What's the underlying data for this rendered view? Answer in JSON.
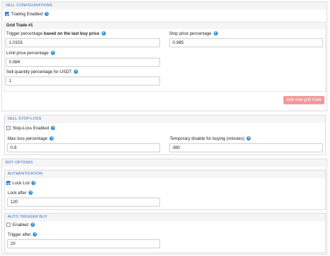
{
  "sell_configurations": {
    "header": "SELL CONFIGURATIONS",
    "trading_enabled_label": "Trading Enabled",
    "trading_enabled_checked": true,
    "grid_title": "Grid Trade #1",
    "trigger_label_pre": "Trigger percentage",
    "trigger_label_bold": "based on the last buy price",
    "trigger_value": "1.0153",
    "stop_price_label": "Stop price percentage",
    "stop_price_value": "0.985",
    "limit_price_label": "Limit price percentage",
    "limit_price_value": "0.984",
    "sell_qty_label": "Sell quantity percentage for USDT",
    "sell_qty_value": "1",
    "add_button": "Add new grid trade"
  },
  "sell_stop_loss": {
    "header": "SELL STOP-LOSS",
    "enabled_label": "Stop-Loss Enabled",
    "enabled_checked": false,
    "max_loss_label": "Max loss percentage",
    "max_loss_value": "0.8",
    "temp_disable_label": "Temporary disable for buying (minutes)",
    "temp_disable_value": "360"
  },
  "bot_options": {
    "header": "BOT OPTIONS",
    "authentication": {
      "header": "AUTHENTICATION",
      "lock_list_label": "Lock List",
      "lock_list_checked": true,
      "lock_after_label": "Lock after",
      "lock_after_value": "120"
    },
    "auto_trigger_buy": {
      "header": "AUTO TRIGGER BUY",
      "enabled_label": "Enabled",
      "enabled_checked": false,
      "trigger_after_label": "Trigger after",
      "trigger_after_value": "20"
    }
  },
  "icons": {
    "help": "help-circle-icon",
    "checkbox": "checkbox-icon"
  },
  "colors": {
    "header_text": "#2f6fc4",
    "help_icon": "#2f8fd3",
    "checkbox_checked": "#2f7fd6",
    "add_button": "#f09a9a"
  }
}
